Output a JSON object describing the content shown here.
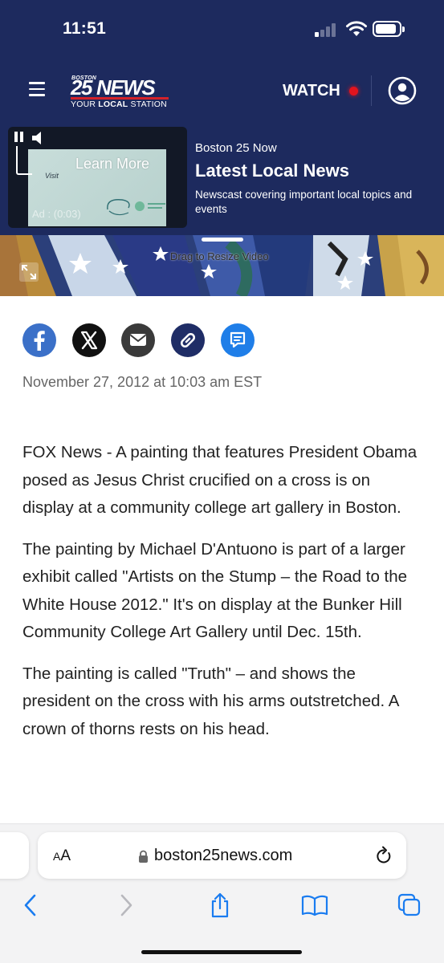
{
  "status_bar": {
    "time": "11:51",
    "battery_level": 0.9
  },
  "header": {
    "logo": {
      "top_text": "BOSTON",
      "main_text": "25 NEWS",
      "tagline_pre": "YOUR ",
      "tagline_bold": "LOCAL",
      "tagline_post": " STATION"
    },
    "watch_label": "WATCH",
    "colors": {
      "background": "#1d2a5e",
      "live_dot": "#e2141e",
      "logo_bar": "#d4222a"
    }
  },
  "video": {
    "learn_more": "Learn More",
    "ad_label": "Ad : (0:03)",
    "ad_script": "Visit",
    "show_label": "Boston 25 Now",
    "title": "Latest Local News",
    "description": "Newscast covering important local topics and events",
    "drag_hint": "Drag to Resize Video"
  },
  "share_buttons": [
    {
      "name": "facebook",
      "color": "#3b70c8"
    },
    {
      "name": "x",
      "color": "#111111"
    },
    {
      "name": "email",
      "color": "#3a3a3a"
    },
    {
      "name": "copy-link",
      "color": "#1f2d66"
    },
    {
      "name": "comments",
      "color": "#1f7ee8"
    }
  ],
  "article": {
    "date": "November 27, 2012 at 10:03 am EST",
    "paragraphs": [
      "FOX News - A painting that features President Obama posed as Jesus Christ crucified on a cross is on display at a community college art gallery in Boston.",
      "The painting by Michael D'Antuono is part of a larger exhibit called \"Artists on the Stump – the Road to the White House 2012.\" It's on display at the Bunker Hill Community College Art Gallery until Dec. 15th.",
      "The painting is called \"Truth\" – and shows the president on the cross with his arms outstretched. A crown of thorns rests on his head."
    ]
  },
  "browser": {
    "aa_large": "A",
    "aa_small": "A",
    "url": "boston25news.com",
    "toolbar_icons": [
      "back-icon",
      "forward-icon",
      "share-icon",
      "bookmarks-icon",
      "tabs-icon"
    ]
  }
}
